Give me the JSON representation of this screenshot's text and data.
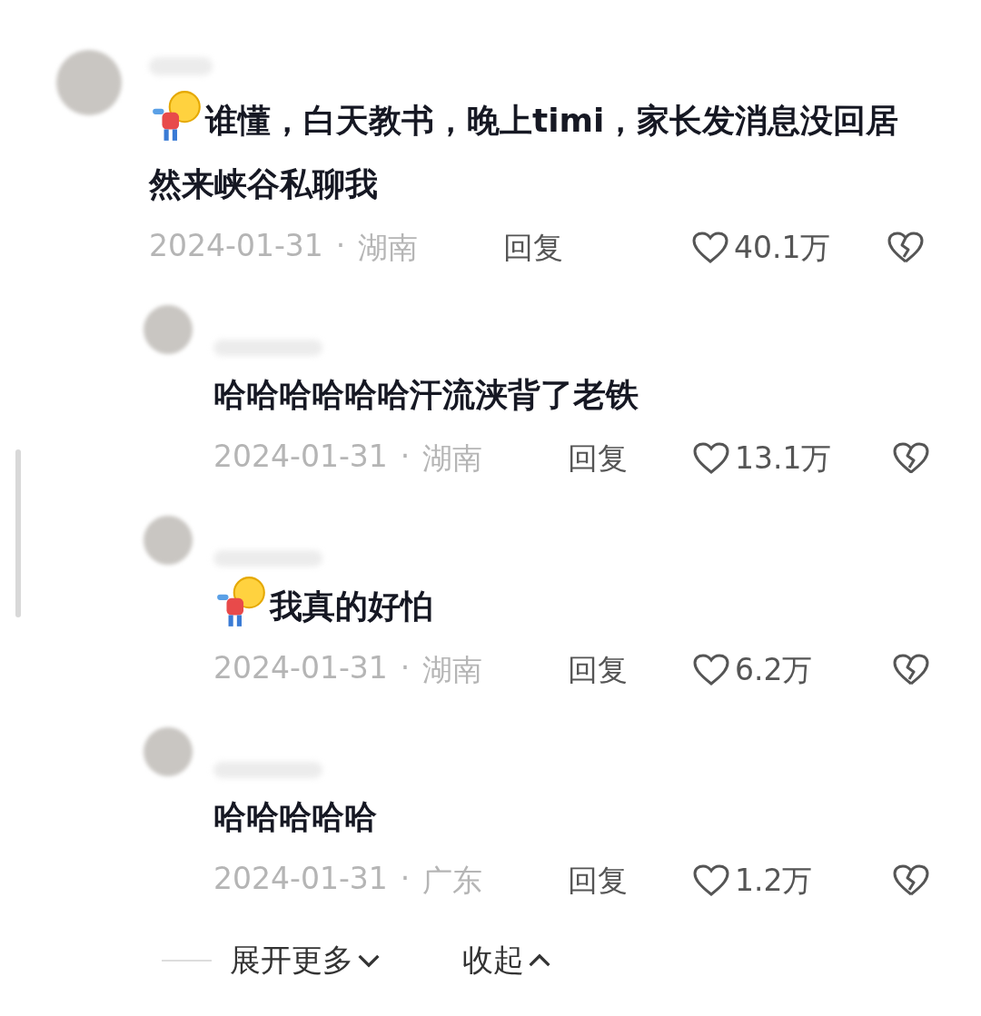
{
  "comments": [
    {
      "kind": "top",
      "emoji": true,
      "text": "谁懂，白天教书，晚上timi，家长发消息没回居然来峡谷私聊我",
      "date": "2024-01-31",
      "separator": "·",
      "region": "湖南",
      "reply": "回复",
      "likes": "40.1万"
    },
    {
      "kind": "reply",
      "emoji": false,
      "text": "哈哈哈哈哈哈汗流浃背了老铁",
      "date": "2024-01-31",
      "separator": "·",
      "region": "湖南",
      "reply": "回复",
      "likes": "13.1万"
    },
    {
      "kind": "reply",
      "emoji": true,
      "text": "我真的好怕",
      "date": "2024-01-31",
      "separator": "·",
      "region": "湖南",
      "reply": "回复",
      "likes": "6.2万"
    },
    {
      "kind": "reply",
      "emoji": false,
      "text": "哈哈哈哈哈",
      "date": "2024-01-31",
      "separator": "·",
      "region": "广东",
      "reply": "回复",
      "likes": "1.2万"
    }
  ],
  "footer": {
    "expand": "展开更多",
    "collapse": "收起"
  }
}
